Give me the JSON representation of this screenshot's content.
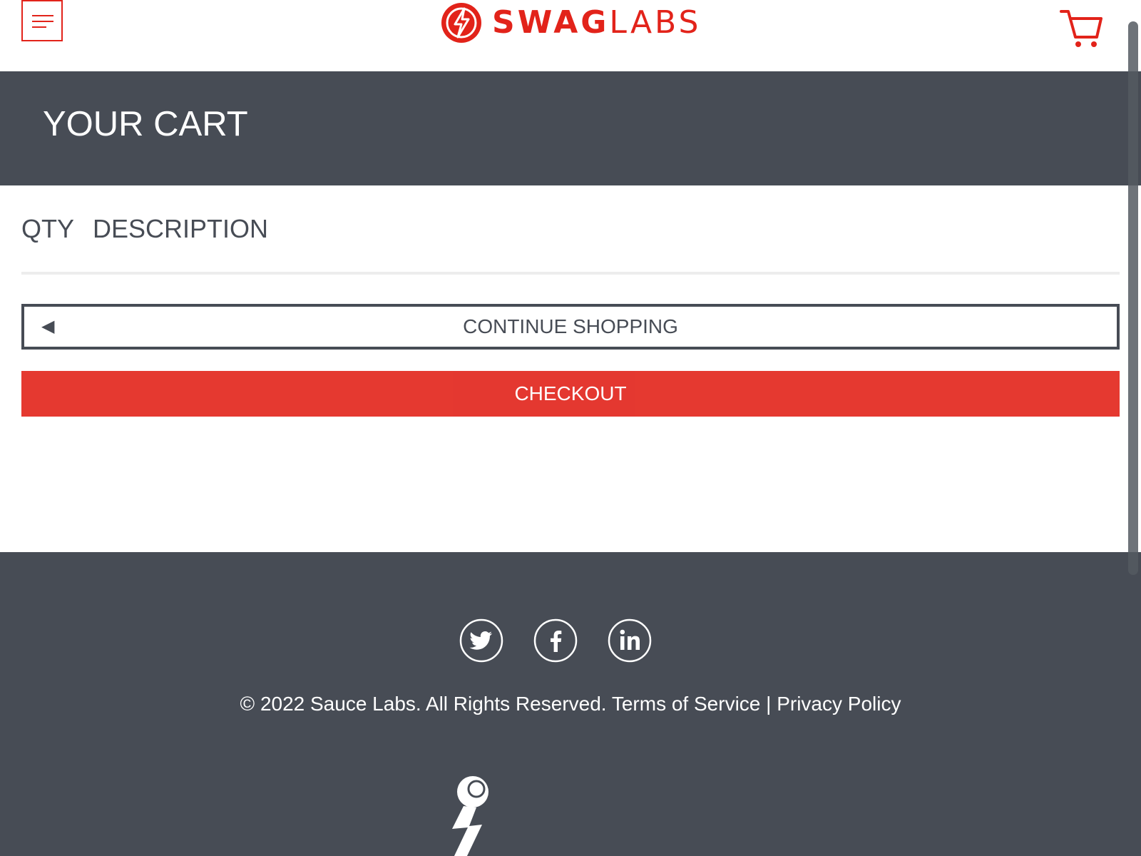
{
  "header": {
    "menu_icon": "hamburger-menu-icon",
    "logo": {
      "text_bold": "SWAG",
      "text_light": "LABS",
      "icon": "lightning-bolt-icon"
    },
    "cart_icon": "shopping-cart-icon"
  },
  "subheader": {
    "title": "YOUR CART"
  },
  "cart_list": {
    "qty_label": "QTY",
    "description_label": "DESCRIPTION",
    "items": []
  },
  "actions": {
    "continue_shopping_label": "CONTINUE SHOPPING",
    "continue_shopping_icon": "◀",
    "checkout_label": "CHECKOUT"
  },
  "footer": {
    "social": [
      {
        "name": "twitter",
        "icon": "twitter-icon"
      },
      {
        "name": "facebook",
        "icon": "facebook-icon"
      },
      {
        "name": "linkedin",
        "icon": "linkedin-icon"
      }
    ],
    "copyright": "© 2022 Sauce Labs. All Rights Reserved.",
    "terms_label": "Terms of Service",
    "separator": "|",
    "privacy_label": "Privacy Policy",
    "mascot_icon": "sauce-labs-robot-icon"
  },
  "colors": {
    "brand_red": "#e2231a",
    "dark_gray": "#474c55",
    "white": "#ffffff"
  }
}
